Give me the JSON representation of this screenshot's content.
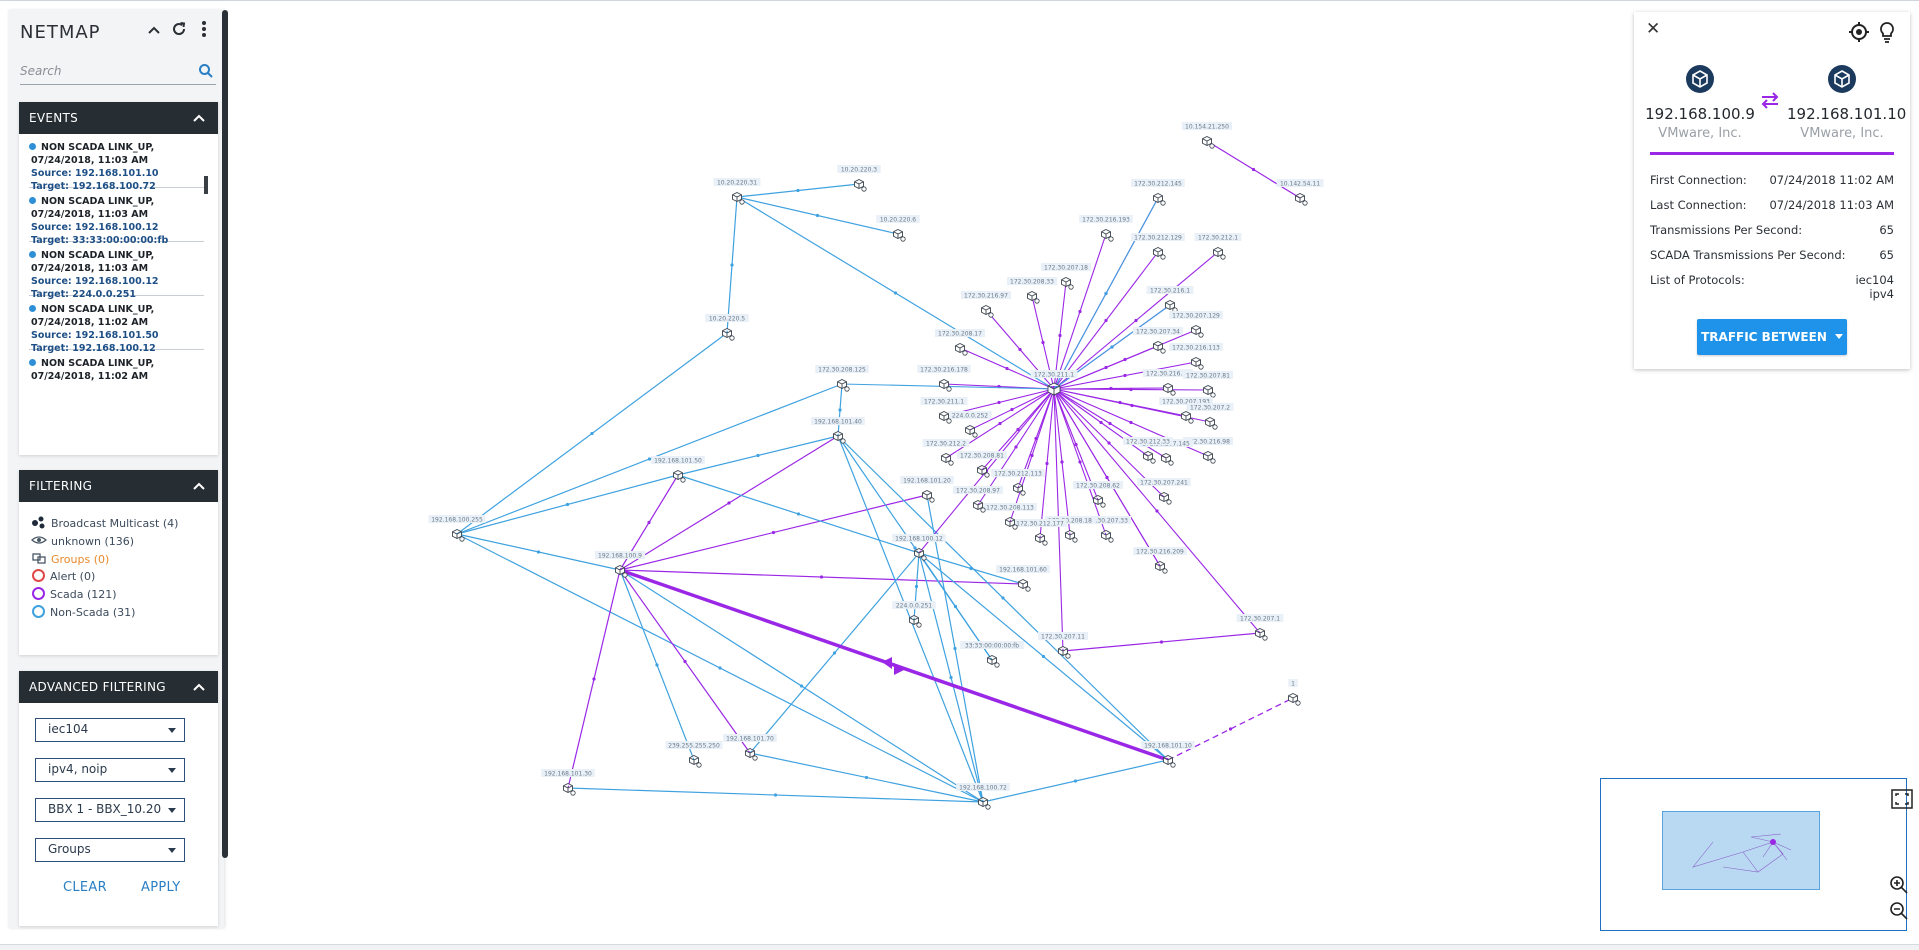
{
  "app": {
    "title": "NETMAP"
  },
  "search": {
    "placeholder": "Search"
  },
  "events": {
    "title": "EVENTS",
    "items": [
      {
        "title": "NON SCADA LINK_UP,",
        "time": "07/24/2018, 11:03 AM",
        "source": "Source: 192.168.101.10",
        "target": "Target: 192.168.100.72"
      },
      {
        "title": "NON SCADA LINK_UP,",
        "time": "07/24/2018, 11:03 AM",
        "source": "Source: 192.168.100.12",
        "target": "Target: 33:33:00:00:00:fb"
      },
      {
        "title": "NON SCADA LINK_UP,",
        "time": "07/24/2018, 11:03 AM",
        "source": "Source: 192.168.100.12",
        "target": "Target: 224.0.0.251"
      },
      {
        "title": "NON SCADA LINK_UP,",
        "time": "07/24/2018, 11:02 AM",
        "source": "Source: 192.168.101.50",
        "target": "Target: 192.168.100.12"
      },
      {
        "title": "NON SCADA LINK_UP,",
        "time": "07/24/2018, 11:02 AM",
        "source": "",
        "target": ""
      }
    ]
  },
  "filtering": {
    "title": "FILTERING",
    "items": {
      "broadcast": "Broadcast Multicast (4)",
      "unknown": "unknown (136)",
      "groups": "Groups (0)",
      "alert": "Alert (0)",
      "scada": "Scada (121)",
      "nonscada": "Non-Scada (31)"
    }
  },
  "advanced": {
    "title": "ADVANCED FILTERING",
    "protocol": "iec104",
    "ipver": "ipv4, noip",
    "bbx": "BBX 1 - BBX_10.20",
    "groups": "Groups",
    "clear": "CLEAR",
    "apply": "APPLY"
  },
  "details": {
    "left": {
      "ip": "192.168.100.9",
      "vendor": "VMware, Inc."
    },
    "right": {
      "ip": "192.168.101.10",
      "vendor": "VMware, Inc."
    },
    "first_label": "First Connection:",
    "first_value": "07/24/2018 11:02 AM",
    "last_label": "Last Connection:",
    "last_value": "07/24/2018 11:03 AM",
    "tps_label": "Transmissions Per Second:",
    "tps_value": "65",
    "stps_label": "SCADA Transmissions Per Second:",
    "stps_value": "65",
    "proto_label": "List of Protocols:",
    "proto_value1": "iec104",
    "proto_value2": "ipv4",
    "button": "TRAFFIC BETWEEN"
  },
  "colors": {
    "scada": "#9b27e6",
    "nonscada": "#3fa2e0",
    "alert": "#e04848",
    "groups": "#e8892b",
    "accent": "#1f93e9",
    "dark": "#262d33"
  },
  "graph": {
    "nodes": [
      {
        "id": "n1",
        "label": "10.20.220.31"
      },
      {
        "id": "n2",
        "label": "10.20.220.3"
      },
      {
        "id": "n3",
        "label": "10.20.220.6"
      },
      {
        "id": "n4",
        "label": "10.20.220.5"
      },
      {
        "id": "n5",
        "label": "192.168.100.255"
      },
      {
        "id": "n6",
        "label": "192.168.100.9"
      },
      {
        "id": "n7",
        "label": "192.168.101.50"
      },
      {
        "id": "n8",
        "label": "192.168.101.40"
      },
      {
        "id": "n9",
        "label": "172.30.208.125"
      },
      {
        "id": "n10",
        "label": "192.168.101.20"
      },
      {
        "id": "n11",
        "label": "192.168.100.12"
      },
      {
        "id": "n12",
        "label": "192.168.101.60"
      },
      {
        "id": "n13",
        "label": "224.0.0.251"
      },
      {
        "id": "n14",
        "label": "33:33:00:00:00:fb"
      },
      {
        "id": "n15",
        "label": "239.255.255.250"
      },
      {
        "id": "n16",
        "label": "192.168.101.70"
      },
      {
        "id": "n17",
        "label": "192.168.101.30"
      },
      {
        "id": "n18",
        "label": "192.168.100.72"
      },
      {
        "id": "n19",
        "label": "192.168.101.10"
      },
      {
        "id": "n20",
        "label": "1"
      },
      {
        "id": "n21",
        "label": "172.30.207.11"
      },
      {
        "id": "n22",
        "label": "172.30.207.1"
      },
      {
        "id": "n23",
        "label": "10.154.21.250"
      },
      {
        "id": "n24",
        "label": "10.142.54.11"
      },
      {
        "id": "hub",
        "label": "172.30.211.1"
      },
      {
        "id": "s1",
        "label": "172.30.216.97"
      },
      {
        "id": "s2",
        "label": "172.30.208.33"
      },
      {
        "id": "s3",
        "label": "172.30.207.18"
      },
      {
        "id": "s4",
        "label": "172.30.216.193"
      },
      {
        "id": "s5",
        "label": "172.30.212.145"
      },
      {
        "id": "s6",
        "label": "172.30.212.129"
      },
      {
        "id": "s7",
        "label": "172.30.212.1"
      },
      {
        "id": "s8",
        "label": "172.30.216.1"
      },
      {
        "id": "s9",
        "label": "172.30.207.34"
      },
      {
        "id": "s10",
        "label": "172.30.207.129"
      },
      {
        "id": "s11",
        "label": "172.30.216.113"
      },
      {
        "id": "s12",
        "label": "172.30.216.17"
      },
      {
        "id": "s13",
        "label": "172.30.207.81"
      },
      {
        "id": "s14",
        "label": "172.30.207.193"
      },
      {
        "id": "s15",
        "label": "172.30.207.2"
      },
      {
        "id": "s16",
        "label": "172.30.216.98"
      },
      {
        "id": "s17",
        "label": "172.30.207.145"
      },
      {
        "id": "s18",
        "label": "172.30.212.33"
      },
      {
        "id": "s19",
        "label": "172.30.207.241"
      },
      {
        "id": "s20",
        "label": "172.30.208.62"
      },
      {
        "id": "s21",
        "label": "172.30.207.33"
      },
      {
        "id": "s22",
        "label": "172.30.208.18"
      },
      {
        "id": "s23",
        "label": "172.30.212.177"
      },
      {
        "id": "s24",
        "label": "172.30.208.113"
      },
      {
        "id": "s25",
        "label": "172.30.208.97"
      },
      {
        "id": "s26",
        "label": "172.30.212.113"
      },
      {
        "id": "s27",
        "label": "172.30.208.81"
      },
      {
        "id": "s28",
        "label": "172.30.212.2"
      },
      {
        "id": "s29",
        "label": "224.0.0.252"
      },
      {
        "id": "s30",
        "label": "172.30.211.1"
      },
      {
        "id": "s31",
        "label": "172.30.216.178"
      },
      {
        "id": "s32",
        "label": "172.30.208.17"
      },
      {
        "id": "s33",
        "label": "172.30.216.209"
      }
    ],
    "edges": [
      [
        "n1",
        "n2",
        "nonscada"
      ],
      [
        "n1",
        "n3",
        "nonscada"
      ],
      [
        "n1",
        "n4",
        "nonscada"
      ],
      [
        "n1",
        "hub",
        "nonscada"
      ],
      [
        "n4",
        "n5",
        "nonscada"
      ],
      [
        "n5",
        "n9",
        "nonscada"
      ],
      [
        "n5",
        "n7",
        "nonscada"
      ],
      [
        "n5",
        "n6",
        "nonscada"
      ],
      [
        "n5",
        "n18",
        "nonscada"
      ],
      [
        "n6",
        "n7",
        "scada"
      ],
      [
        "n6",
        "n8",
        "scada"
      ],
      [
        "n6",
        "n10",
        "scada"
      ],
      [
        "n6",
        "n12",
        "scada"
      ],
      [
        "n6",
        "n15",
        "nonscada"
      ],
      [
        "n6",
        "n16",
        "scada"
      ],
      [
        "n6",
        "n17",
        "scada"
      ],
      [
        "n6",
        "n18",
        "nonscada"
      ],
      [
        "n7",
        "n11",
        "nonscada"
      ],
      [
        "n7",
        "n8",
        "nonscada"
      ],
      [
        "n8",
        "n18",
        "nonscada"
      ],
      [
        "n8",
        "n14",
        "nonscada"
      ],
      [
        "n8",
        "n19",
        "nonscada"
      ],
      [
        "n11",
        "n13",
        "nonscada"
      ],
      [
        "n11",
        "n14",
        "nonscada"
      ],
      [
        "n11",
        "n12",
        "nonscada"
      ],
      [
        "n11",
        "n16",
        "nonscada"
      ],
      [
        "n11",
        "n18",
        "nonscada"
      ],
      [
        "n11",
        "n19",
        "nonscada"
      ],
      [
        "n10",
        "n18",
        "nonscada"
      ],
      [
        "n16",
        "n18",
        "nonscada"
      ],
      [
        "n17",
        "n18",
        "nonscada"
      ],
      [
        "n18",
        "n19",
        "nonscada"
      ],
      [
        "n21",
        "n22",
        "scada"
      ],
      [
        "n23",
        "n24",
        "scada"
      ],
      [
        "n8",
        "n9",
        "nonscada"
      ]
    ]
  }
}
